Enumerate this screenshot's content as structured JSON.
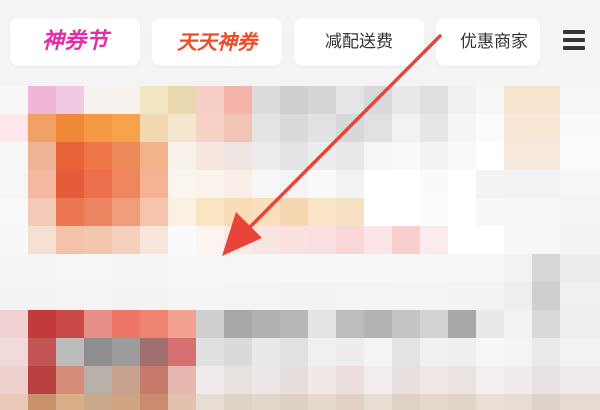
{
  "tabs": [
    {
      "label": "神券节",
      "color": "#e52ca9"
    },
    {
      "label": "天天神券",
      "color": "#f04a22"
    },
    {
      "label": "减配送费",
      "color": "#333333"
    },
    {
      "label": "优惠商家",
      "color": "#333333"
    }
  ],
  "menu": {
    "icon": "menu-icon"
  },
  "annotation": {
    "color": "#e8443a",
    "icon": "arrow-icon"
  },
  "feed": {
    "state": "pixelated"
  }
}
